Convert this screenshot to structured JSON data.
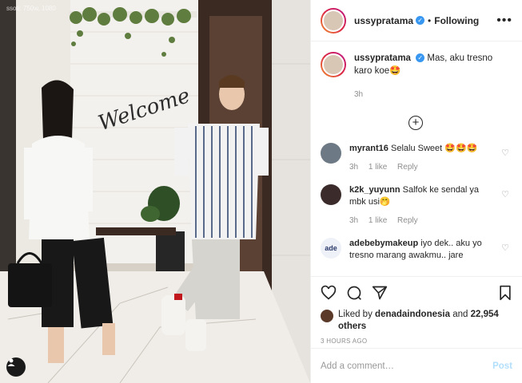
{
  "photo": {
    "corner_meta": "ssoti: 750w, 1080"
  },
  "post": {
    "username": "ussypratama",
    "follow_label": "Following",
    "more_icon": "more-icon"
  },
  "caption": {
    "username": "ussypratama",
    "text": "Mas, aku tresno karo koe🤩",
    "time": "3h"
  },
  "comments": [
    {
      "username": "myrant16",
      "text": "Selalu Sweet 🤩🤩🤩",
      "time": "3h",
      "likes": "1 like",
      "reply": "Reply",
      "avatar_color": "#6d7a86"
    },
    {
      "username": "k2k_yuyunn",
      "text": "Salfok ke sendal ya mbk usi🤭",
      "time": "3h",
      "likes": "1 like",
      "reply": "Reply",
      "avatar_color": "#3b2b2b"
    },
    {
      "username": "adebebymakeup",
      "text": "iyo dek.. aku yo tresno marang awakmu.. jare",
      "avatar_text": "ade",
      "avatar_color": "#eef1f8"
    }
  ],
  "actions": {
    "liked_by_prefix": "Liked by",
    "liked_by_user": "denadaindonesia",
    "liked_and": "and",
    "others": "22,954 others",
    "time_ago": "3 HOURS AGO"
  },
  "add_comment": {
    "placeholder": "Add a comment…",
    "post_label": "Post"
  },
  "colors": {
    "verified": "#3897f0",
    "muted": "#8e8e8e",
    "post_disabled": "#b2dffc"
  }
}
